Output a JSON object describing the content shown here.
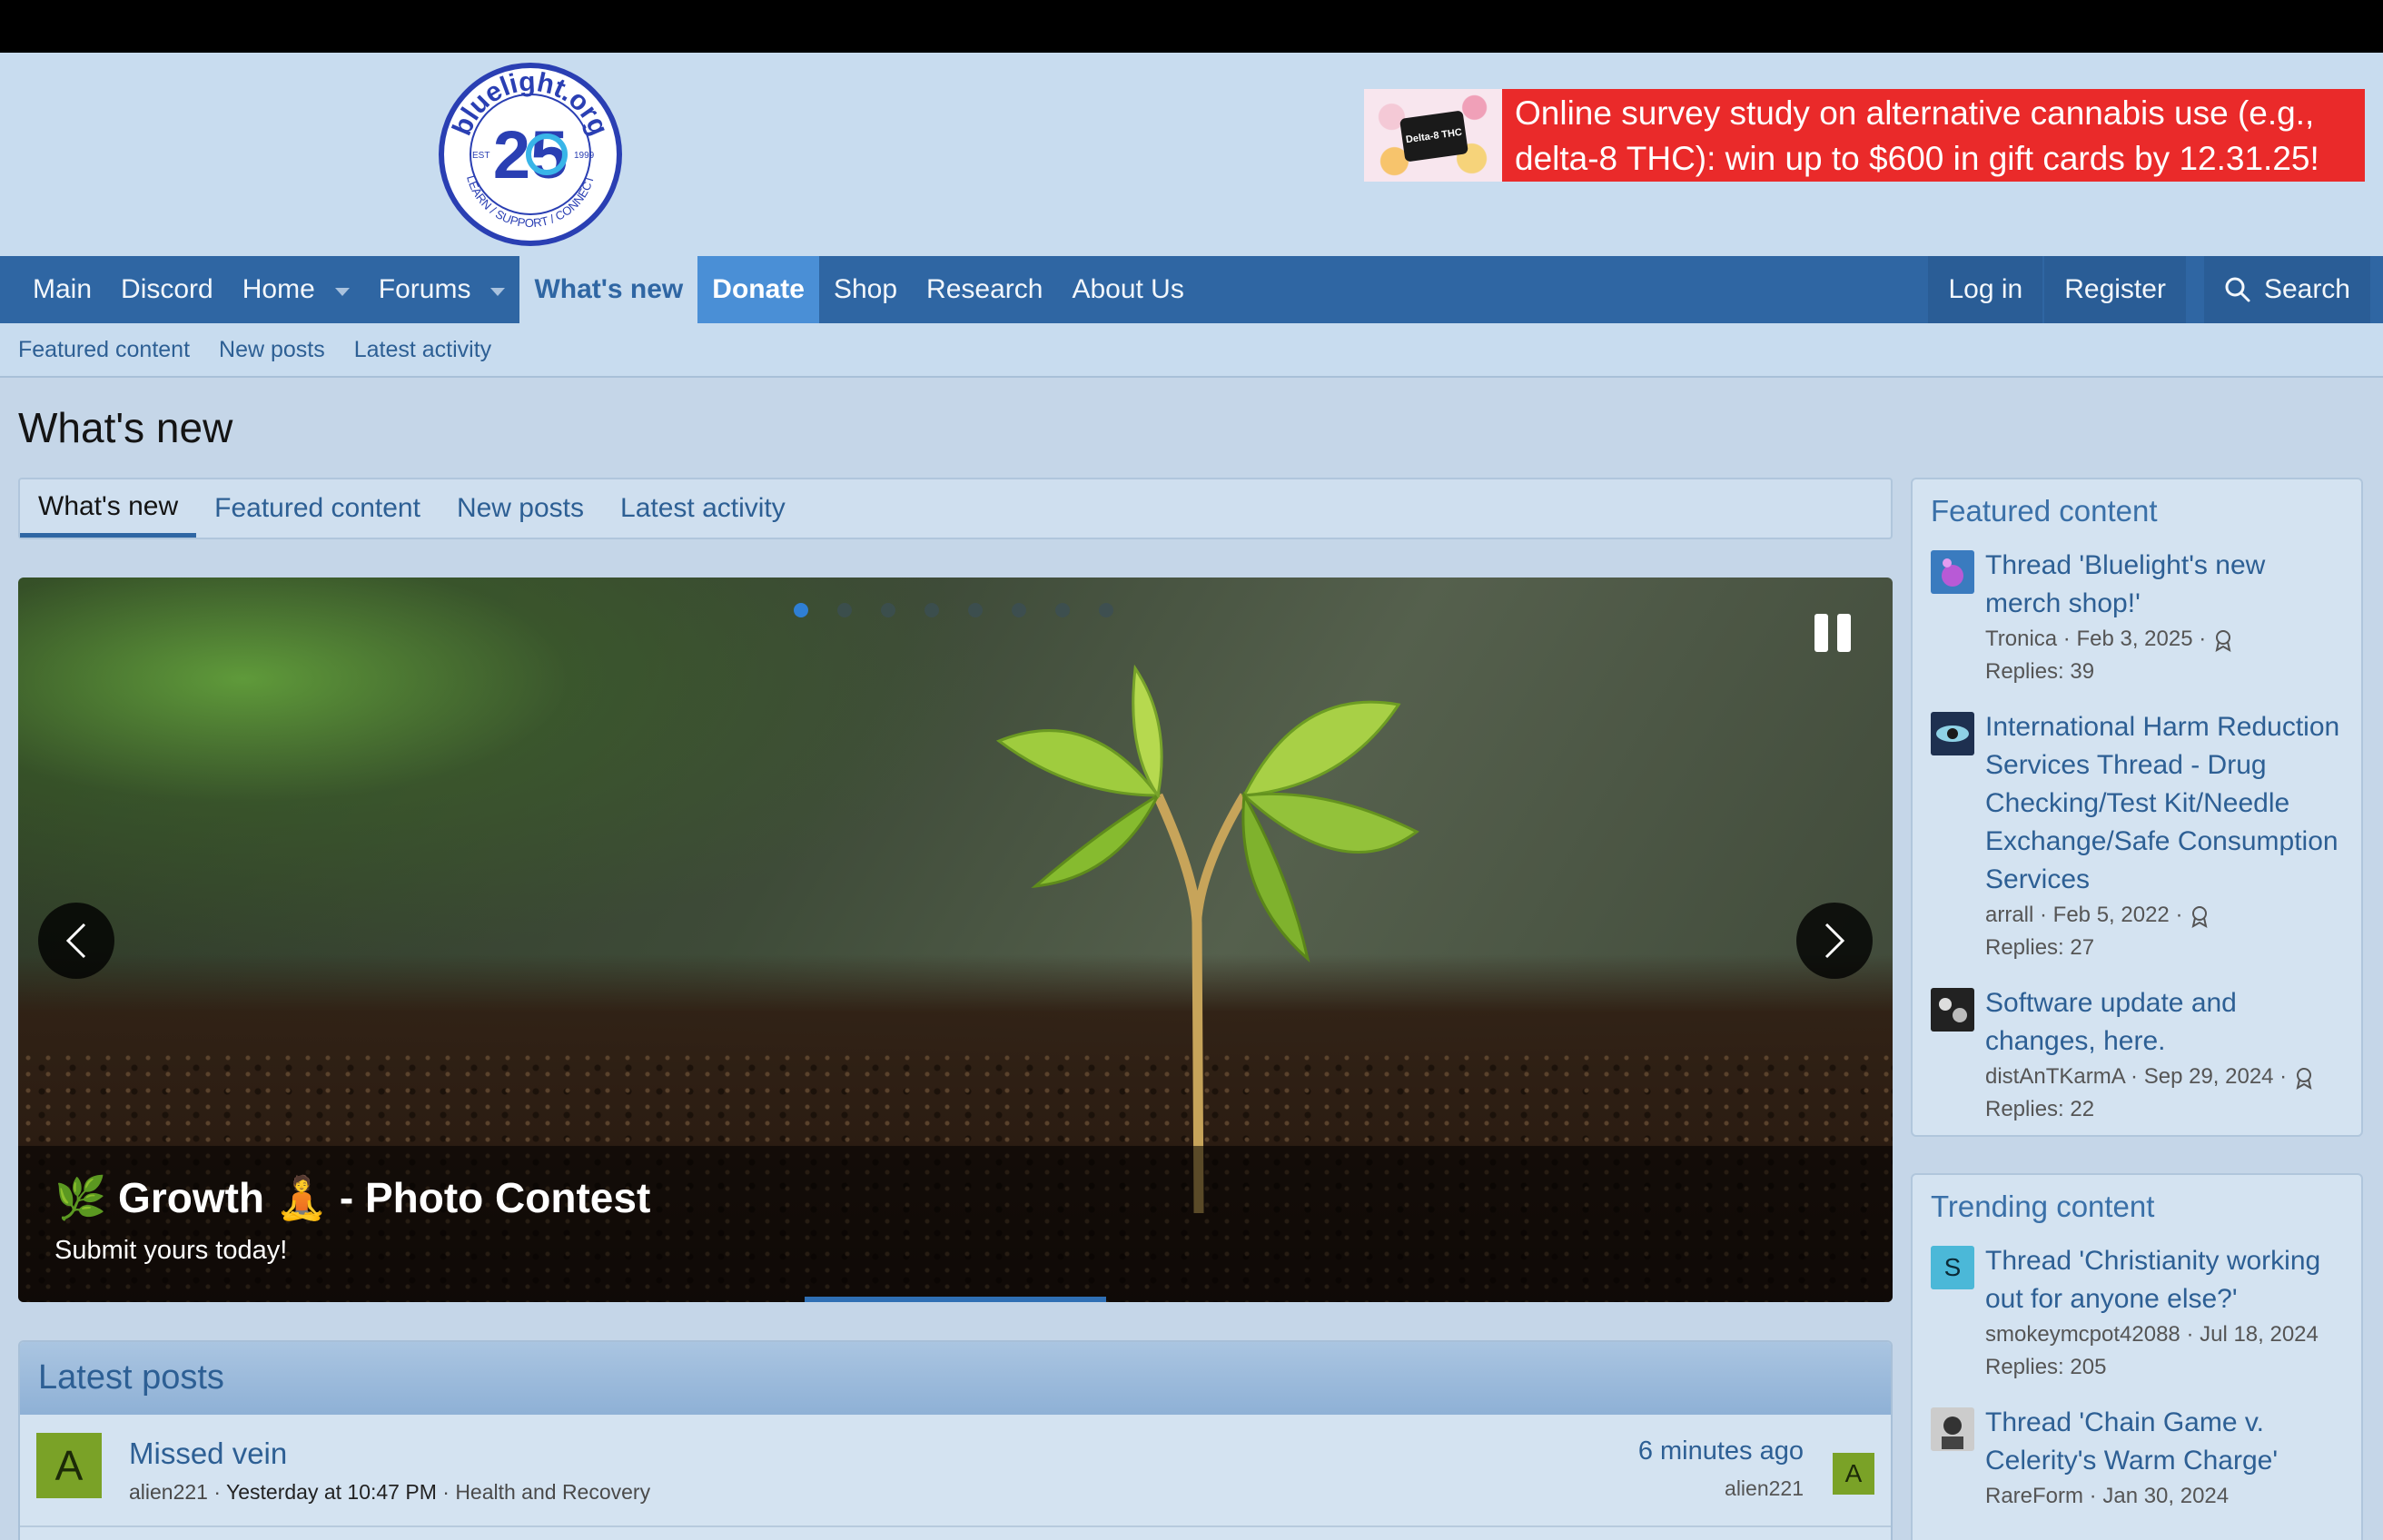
{
  "header": {
    "logo_text": "bluelight.org",
    "logo_est": "EST",
    "logo_year": "1999",
    "logo_motto": "LEARN / SUPPORT / CONNECT",
    "ad_card_text": "Delta-8 THC",
    "ad_text": "Online survey study on alternative cannabis use (e.g., delta-8 THC): win up to $600 in gift cards by 12.31.25!"
  },
  "nav": {
    "items": [
      {
        "label": "Main"
      },
      {
        "label": "Discord"
      },
      {
        "label": "Home"
      },
      {
        "label": "Forums"
      },
      {
        "label": "What's new"
      },
      {
        "label": "Donate"
      },
      {
        "label": "Shop"
      },
      {
        "label": "Research"
      },
      {
        "label": "About Us"
      }
    ],
    "login": "Log in",
    "register": "Register",
    "search": "Search"
  },
  "subnav": [
    "Featured content",
    "New posts",
    "Latest activity"
  ],
  "page_title": "What's new",
  "tabs": [
    "What's new",
    "Featured content",
    "New posts",
    "Latest activity"
  ],
  "slider": {
    "title": "🌿 Growth 🧘 - Photo Contest",
    "subtitle": "Submit yours today!",
    "slide_count": 8,
    "active_slide": 1
  },
  "latest": {
    "heading": "Latest posts",
    "posts": [
      {
        "avatar_letter": "A",
        "title": "Missed vein",
        "author": "alien221",
        "date": "Yesterday at 10:47 PM",
        "forum": "Health and Recovery",
        "time": "6 minutes ago",
        "last_user": "alien221"
      }
    ]
  },
  "featured": {
    "heading": "Featured content",
    "items": [
      {
        "title": "Thread 'Bluelight's new merch shop!'",
        "author": "Tronica",
        "date": "Feb 3, 2025",
        "replies": "Replies: 39"
      },
      {
        "title": "International Harm Reduction Services Thread - Drug Checking/Test Kit/Needle Exchange/Safe Consumption Services",
        "author": "arrall",
        "date": "Feb 5, 2022",
        "replies": "Replies: 27"
      },
      {
        "title": "Software update and changes, here.",
        "author": "distAnTKarmA",
        "date": "Sep 29, 2024",
        "replies": "Replies: 22"
      }
    ]
  },
  "trending": {
    "heading": "Trending content",
    "items": [
      {
        "avatar_letter": "S",
        "title": "Thread 'Christianity working out for anyone else?'",
        "author": "smokeymcpot42088",
        "date": "Jul 18, 2024",
        "replies": "Replies: 205"
      },
      {
        "title": "Thread 'Chain Game v. Celerity's Warm Charge'",
        "author": "RareForm",
        "date": "Jan 30, 2024"
      }
    ]
  },
  "colors": {
    "nav_bg": "#2f66a3",
    "donate_bg": "#4a8fd6",
    "link": "#2d5f94",
    "ad_bg": "#ea2a2a"
  }
}
